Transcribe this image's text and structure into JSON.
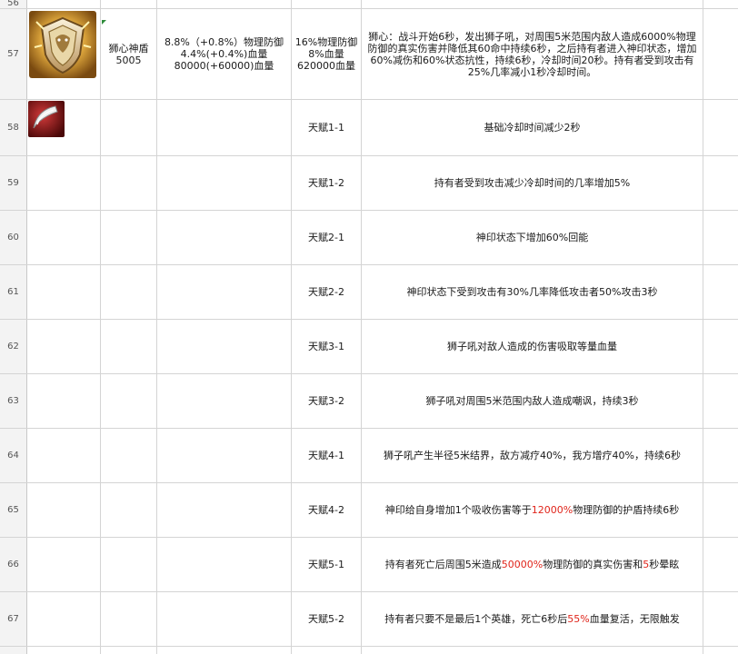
{
  "colors": {
    "row_header_bg": "#f3f3f3",
    "gridline": "#d4d4d4",
    "highlight_red": "#e0251b",
    "comment_marker_green": "#2e8b3a"
  },
  "top_partial_row": {
    "number": "56"
  },
  "rows": [
    {
      "number": "57",
      "icon": "lion-shield-icon",
      "name": "狮心神盾",
      "id": "5005",
      "stats": [
        "8.8%（+0.8%）物理防御",
        "4.4%(+0.4%)血量",
        "80000(+60000)血量"
      ],
      "bonus": [
        "16%物理防御",
        "8%血量",
        "620000血量"
      ],
      "description": "狮心：战斗开始6秒，发出狮子吼，对周围5米范围内敌人造成6000%物理防御的真实伤害并降低其60命中持续6秒，之后持有者进入神印状态，增加60%减伤和60%状态抗性，持续6秒，冷却时间20秒。持有者受到攻击有25%几率减小1秒冷却时间。"
    },
    {
      "number": "58",
      "icon": "red-blade-icon",
      "talent": "天赋1-1",
      "description": "基础冷却时间减少2秒"
    },
    {
      "number": "59",
      "talent": "天赋1-2",
      "description": "持有者受到攻击减少冷却时间的几率增加5%"
    },
    {
      "number": "60",
      "talent": "天赋2-1",
      "description": "神印状态下增加60%回能"
    },
    {
      "number": "61",
      "talent": "天赋2-2",
      "description": "神印状态下受到攻击有30%几率降低攻击者50%攻击3秒"
    },
    {
      "number": "62",
      "talent": "天赋3-1",
      "description": "狮子吼对敌人造成的伤害吸取等量血量"
    },
    {
      "number": "63",
      "talent": "天赋3-2",
      "description": "狮子吼对周围5米范围内敌人造成嘲讽，持续3秒"
    },
    {
      "number": "64",
      "talent": "天赋4-1",
      "description": "狮子吼产生半径5米结界，敌方减疗40%，我方增疗40%，持续6秒"
    },
    {
      "number": "65",
      "talent": "天赋4-2",
      "desc_pre": "神印给自身增加1个吸收伤害等于",
      "desc_red": "12000%",
      "desc_post": "物理防御的护盾持续6秒"
    },
    {
      "number": "66",
      "talent": "天赋5-1",
      "desc_pre": "持有者死亡后周围5米造成",
      "desc_red": "50000%",
      "desc_mid": "物理防御的真实伤害和",
      "desc_red2": "5",
      "desc_post": "秒晕眩"
    },
    {
      "number": "67",
      "talent": "天赋5-2",
      "desc_pre": "持有者只要不是最后1个英雄，死亡6秒后",
      "desc_red": "55%",
      "desc_post": "血量复活，无限触发"
    },
    {
      "number": ""
    }
  ]
}
